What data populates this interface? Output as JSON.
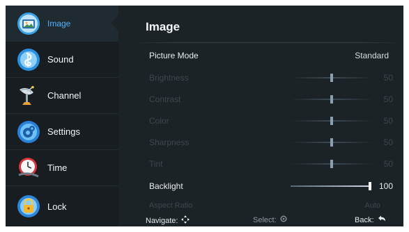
{
  "sidebar": {
    "items": [
      {
        "label": "Image",
        "icon": "image-icon",
        "active": true
      },
      {
        "label": "Sound",
        "icon": "music-note-icon",
        "active": false
      },
      {
        "label": "Channel",
        "icon": "satellite-dish-icon",
        "active": false
      },
      {
        "label": "Settings",
        "icon": "settings-gear-icon",
        "active": false
      },
      {
        "label": "Time",
        "icon": "clock-icon",
        "active": false
      },
      {
        "label": "Lock",
        "icon": "lock-icon",
        "active": false
      }
    ]
  },
  "main": {
    "title": "Image",
    "picture_mode": {
      "label": "Picture Mode",
      "value": "Standard"
    },
    "settings": [
      {
        "label": "Brightness",
        "value": "50",
        "level": 0.5,
        "enabled": false
      },
      {
        "label": "Contrast",
        "value": "50",
        "level": 0.5,
        "enabled": false
      },
      {
        "label": "Color",
        "value": "50",
        "level": 0.5,
        "enabled": false
      },
      {
        "label": "Sharpness",
        "value": "50",
        "level": 0.5,
        "enabled": false
      },
      {
        "label": "Tint",
        "value": "50",
        "level": 0.5,
        "enabled": false
      },
      {
        "label": "Backlight",
        "value": "100",
        "level": 1.0,
        "enabled": true
      }
    ],
    "aspect_ratio": {
      "label": "Aspect Ratio",
      "value": "Auto"
    }
  },
  "footer": {
    "navigate_label": "Navigate:",
    "select_label": "Select:",
    "back_label": "Back:"
  },
  "colors": {
    "accent": "#4fb2ff",
    "background": "#1c2327",
    "sidebar_background": "#171d21",
    "disabled_text": "#3b474f"
  }
}
